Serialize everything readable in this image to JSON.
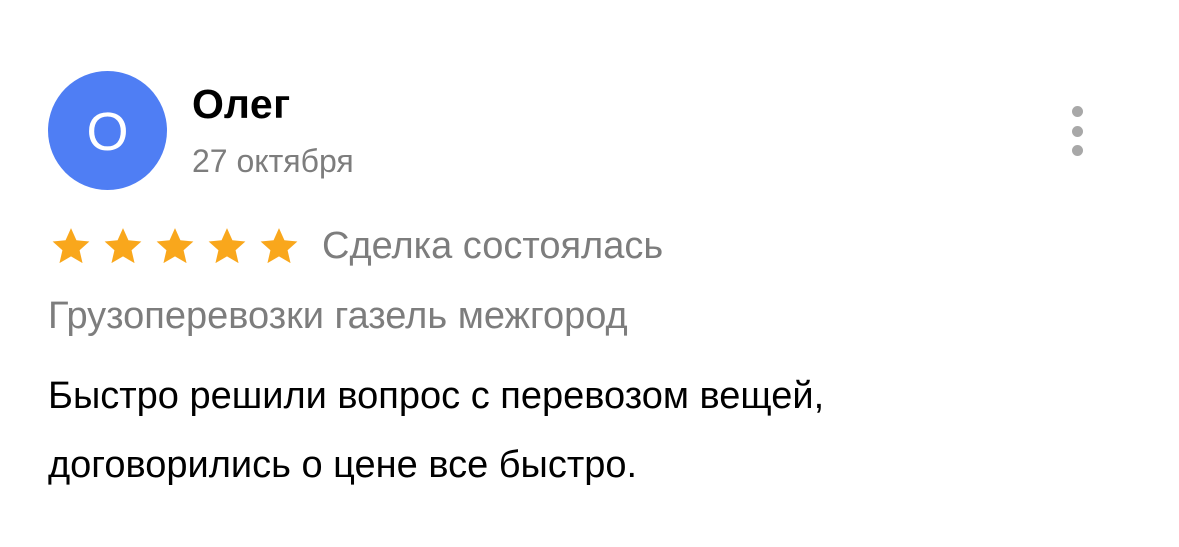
{
  "review": {
    "author": {
      "initial": "О",
      "name": "Олег",
      "avatar_color": "#4f7ef4"
    },
    "date": "27 октября",
    "menu_icon": "more-vertical-icon",
    "rating": {
      "value": 5,
      "max": 5,
      "star_color": "#f9a71c",
      "star_icon": "star-icon"
    },
    "deal_status": "Сделка состоялась",
    "service": "Грузоперевозки газель межгород",
    "text_lines": [
      "Быстро решили вопрос с перевозом вещей,",
      "договорились о цене все быстро."
    ]
  }
}
